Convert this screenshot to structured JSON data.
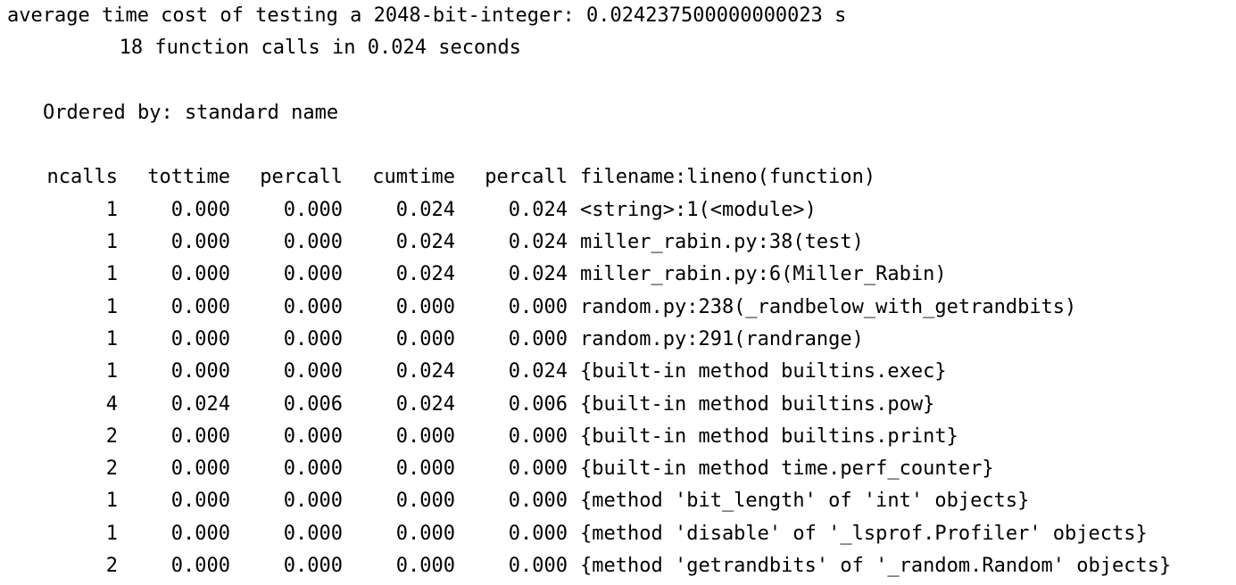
{
  "output": {
    "summary_line": "average time cost of testing a 2048-bit-integer: 0.024237500000000023 s",
    "calls_line": "18 function calls in 0.024 seconds",
    "ordered_line": "Ordered by: standard name"
  },
  "table": {
    "headers": {
      "ncalls": "ncalls",
      "tottime": "tottime",
      "percall1": "percall",
      "cumtime": "cumtime",
      "percall2": "percall",
      "func": "filename:lineno(function)"
    },
    "rows": [
      {
        "ncalls": "1",
        "tottime": "0.000",
        "percall1": "0.000",
        "cumtime": "0.024",
        "percall2": "0.024",
        "func": "<string>:1(<module>)"
      },
      {
        "ncalls": "1",
        "tottime": "0.000",
        "percall1": "0.000",
        "cumtime": "0.024",
        "percall2": "0.024",
        "func": "miller_rabin.py:38(test)"
      },
      {
        "ncalls": "1",
        "tottime": "0.000",
        "percall1": "0.000",
        "cumtime": "0.024",
        "percall2": "0.024",
        "func": "miller_rabin.py:6(Miller_Rabin)"
      },
      {
        "ncalls": "1",
        "tottime": "0.000",
        "percall1": "0.000",
        "cumtime": "0.000",
        "percall2": "0.000",
        "func": "random.py:238(_randbelow_with_getrandbits)"
      },
      {
        "ncalls": "1",
        "tottime": "0.000",
        "percall1": "0.000",
        "cumtime": "0.000",
        "percall2": "0.000",
        "func": "random.py:291(randrange)"
      },
      {
        "ncalls": "1",
        "tottime": "0.000",
        "percall1": "0.000",
        "cumtime": "0.024",
        "percall2": "0.024",
        "func": "{built-in method builtins.exec}"
      },
      {
        "ncalls": "4",
        "tottime": "0.024",
        "percall1": "0.006",
        "cumtime": "0.024",
        "percall2": "0.006",
        "func": "{built-in method builtins.pow}"
      },
      {
        "ncalls": "2",
        "tottime": "0.000",
        "percall1": "0.000",
        "cumtime": "0.000",
        "percall2": "0.000",
        "func": "{built-in method builtins.print}"
      },
      {
        "ncalls": "2",
        "tottime": "0.000",
        "percall1": "0.000",
        "cumtime": "0.000",
        "percall2": "0.000",
        "func": "{built-in method time.perf_counter}"
      },
      {
        "ncalls": "1",
        "tottime": "0.000",
        "percall1": "0.000",
        "cumtime": "0.000",
        "percall2": "0.000",
        "func": "{method 'bit_length' of 'int' objects}"
      },
      {
        "ncalls": "1",
        "tottime": "0.000",
        "percall1": "0.000",
        "cumtime": "0.000",
        "percall2": "0.000",
        "func": "{method 'disable' of '_lsprof.Profiler' objects}"
      },
      {
        "ncalls": "2",
        "tottime": "0.000",
        "percall1": "0.000",
        "cumtime": "0.000",
        "percall2": "0.000",
        "func": "{method 'getrandbits' of '_random.Random' objects}"
      }
    ]
  },
  "colors": {
    "text": "#000000",
    "background": "#ffffff"
  }
}
